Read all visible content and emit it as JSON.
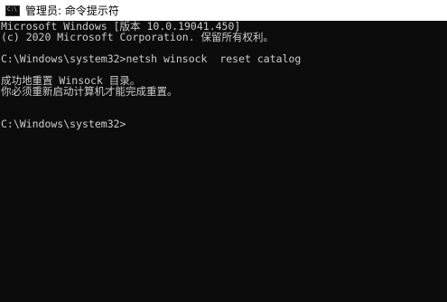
{
  "window": {
    "title": "管理员: 命令提示符",
    "icon_name": "cmd-icon",
    "icon_glyph": "C:\\"
  },
  "console": {
    "header_line_1": "Microsoft Windows [版本 10.0.19041.450]",
    "header_line_2": "(c) 2020 Microsoft Corporation. 保留所有权利。",
    "prompt_1": "C:\\Windows\\system32>netsh winsock  reset catalog",
    "output_line_1": "成功地重置 Winsock 目录。",
    "output_line_2": "你必须重新启动计算机才能完成重置。",
    "prompt_2": "C:\\Windows\\system32>"
  },
  "colors": {
    "console_background": "#0c0c0c",
    "console_text": "#cccccc",
    "titlebar_background": "#ffffff"
  }
}
